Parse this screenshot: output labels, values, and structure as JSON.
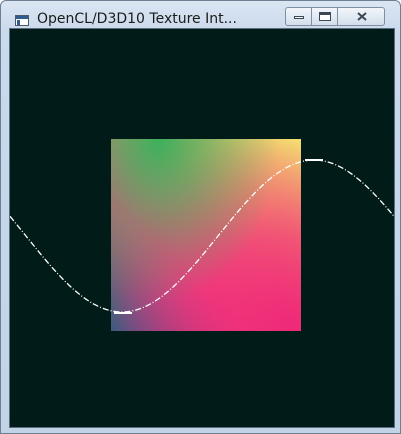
{
  "window": {
    "title": "OpenCL/D3D10 Texture Int...",
    "icon": "app-window-icon"
  },
  "caption_buttons": {
    "minimize_icon": "minimize-icon",
    "maximize_icon": "maximize-icon",
    "close_icon": "close-icon",
    "close_glyph": "☒"
  },
  "render": {
    "background": "#001b18",
    "texture_colors": [
      "#07a36a",
      "#f4ee70",
      "#ef2878",
      "#3b2c7c"
    ],
    "wave_color": "#ffffff"
  }
}
